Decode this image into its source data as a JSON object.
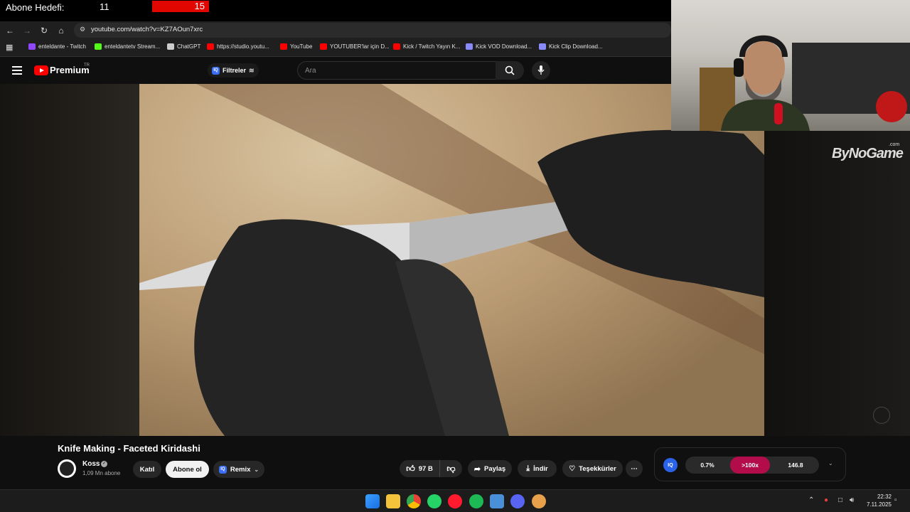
{
  "overlay": {
    "goal_label": "Abone Hedefi:",
    "goal_current": "11",
    "goal_target": "15",
    "progress_fraction": 0.73
  },
  "browser": {
    "url": "youtube.com/watch?v=KZ7AOun7xrc",
    "bookmarks": [
      {
        "label": "enteldante - Twitch",
        "color": "#9146ff"
      },
      {
        "label": "enteldantetv Stream...",
        "color": "#53fc18"
      },
      {
        "label": "ChatGPT",
        "color": "#cccccc"
      },
      {
        "label": "https://studio.youtu...",
        "color": "#ff0000"
      },
      {
        "label": "YouTube",
        "color": "#ff0000"
      },
      {
        "label": "YOUTUBER'lar için D...",
        "color": "#ff0000"
      },
      {
        "label": "Kick / Twitch Yayın K...",
        "color": "#ff0000"
      },
      {
        "label": "Kick VOD Download...",
        "color": "#8a8aff"
      },
      {
        "label": "Kick Clip Download...",
        "color": "#8a8aff"
      }
    ]
  },
  "youtube": {
    "brand": "Premium",
    "country": "TR",
    "filters_label": "Filtreler",
    "search_placeholder": "Ara"
  },
  "video": {
    "title": "Knife Making - Faceted Kiridashi",
    "watermark": "ByNoGame",
    "watermark_suffix": ".com"
  },
  "channel": {
    "name": "Koss",
    "subscribers": "1,09 Mn abone",
    "join_label": "Katıl",
    "subscribe_label": "Abone ol",
    "remix_label": "Remix"
  },
  "actions": {
    "likes": "97 B",
    "share": "Paylaş",
    "download": "İndir",
    "thanks": "Teşekkürler"
  },
  "iq_widget": {
    "logo": "IQ",
    "stat_1": "0.7%",
    "stat_2": ">100x",
    "stat_3": "146.8"
  },
  "taskbar": {
    "time": "22:32",
    "date": "7.11.2025"
  },
  "colors": {
    "youtube_red": "#ff0000",
    "overlay_red": "#e10600",
    "iq_accent": "#b30c4a"
  }
}
